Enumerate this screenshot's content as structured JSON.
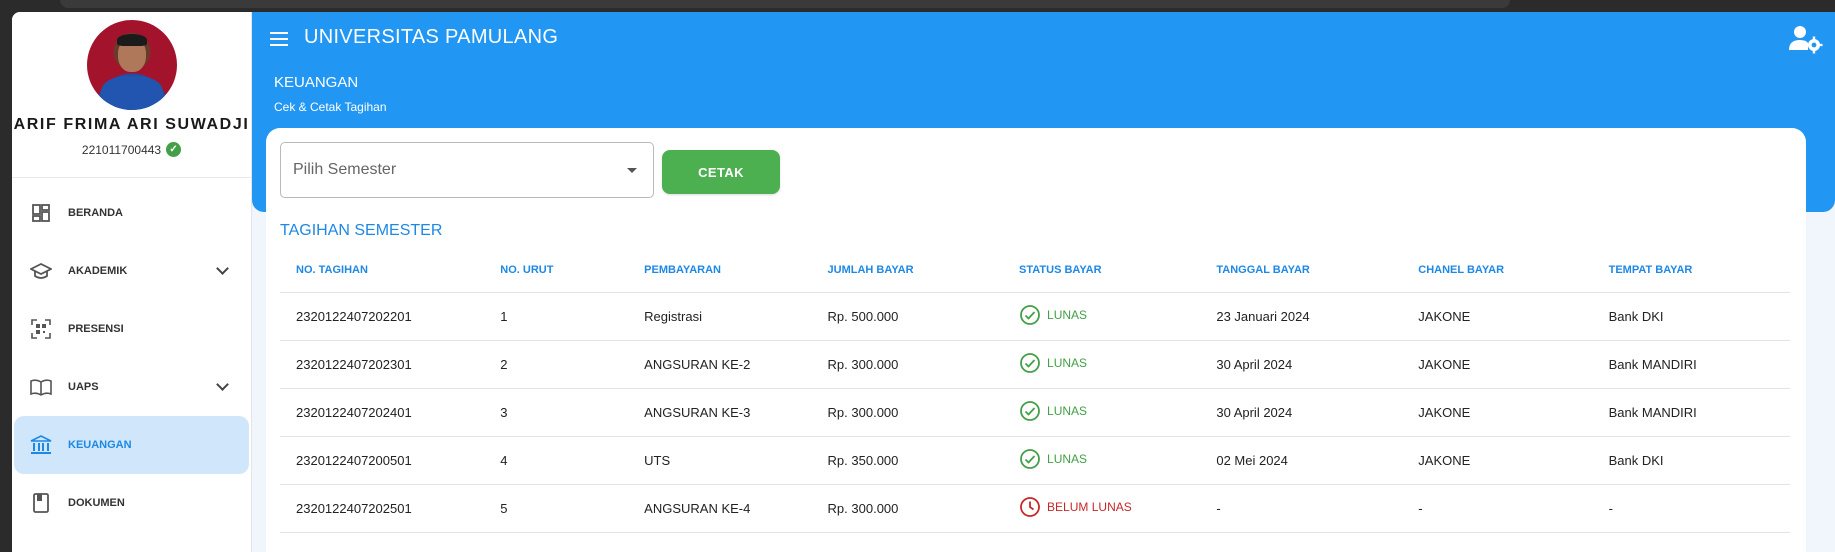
{
  "app": {
    "title": "UNIVERSITAS PAMULANG"
  },
  "profile": {
    "name": "ARIF FRIMA ARI SUWADJI",
    "nim": "221011700443"
  },
  "sidebar": {
    "items": [
      {
        "label": "BERANDA",
        "icon": "dashboard-icon",
        "active": false,
        "expandable": false
      },
      {
        "label": "AKADEMIK",
        "icon": "graduation-cap-icon",
        "active": false,
        "expandable": true
      },
      {
        "label": "PRESENSI",
        "icon": "qr-scan-icon",
        "active": false,
        "expandable": false
      },
      {
        "label": "UAPS",
        "icon": "book-open-icon",
        "active": false,
        "expandable": true
      },
      {
        "label": "KEUANGAN",
        "icon": "bank-icon",
        "active": true,
        "expandable": false
      },
      {
        "label": "DOKUMEN",
        "icon": "document-icon",
        "active": false,
        "expandable": false
      }
    ]
  },
  "header": {
    "page_title": "KEUANGAN",
    "page_subtitle": "Cek & Cetak Tagihan"
  },
  "filter": {
    "semester_placeholder": "Pilih Semester",
    "print_label": "CETAK"
  },
  "table": {
    "title": "TAGIHAN SEMESTER",
    "columns": [
      "NO. TAGIHAN",
      "NO. URUT",
      "PEMBAYARAN",
      "JUMLAH BAYAR",
      "STATUS BAYAR",
      "TANGGAL BAYAR",
      "CHANEL BAYAR",
      "TEMPAT BAYAR"
    ],
    "rows": [
      [
        "2320122407202201",
        "1",
        "Registrasi",
        "Rp. 500.000",
        "LUNAS",
        "23 Januari 2024",
        "JAKONE",
        "Bank DKI"
      ],
      [
        "2320122407202301",
        "2",
        "ANGSURAN KE-2",
        "Rp. 300.000",
        "LUNAS",
        "30 April 2024",
        "JAKONE",
        "Bank MANDIRI"
      ],
      [
        "2320122407202401",
        "3",
        "ANGSURAN KE-3",
        "Rp. 300.000",
        "LUNAS",
        "30 April 2024",
        "JAKONE",
        "Bank MANDIRI"
      ],
      [
        "2320122407200501",
        "4",
        "UTS",
        "Rp. 350.000",
        "LUNAS",
        "02 Mei 2024",
        "JAKONE",
        "Bank DKI"
      ],
      [
        "2320122407202501",
        "5",
        "ANGSURAN KE-4",
        "Rp. 300.000",
        "BELUM LUNAS",
        "-",
        "-",
        "-"
      ]
    ]
  },
  "colors": {
    "primary": "#2196f3",
    "success": "#43a047",
    "danger": "#c62828",
    "button": "#4caf50"
  }
}
